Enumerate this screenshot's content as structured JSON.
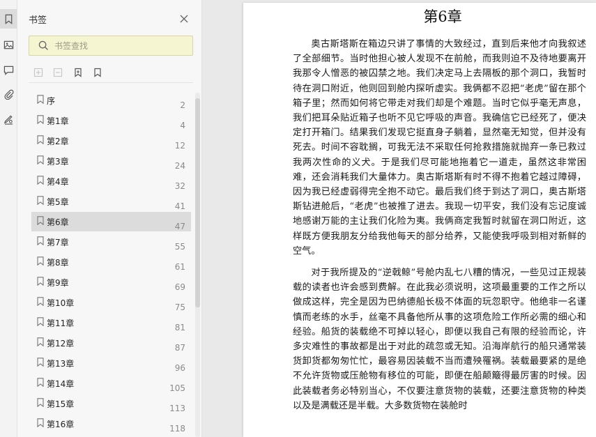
{
  "sidebar_panel": {
    "title": "书签",
    "search_placeholder": "书签查找",
    "bookmarks": [
      {
        "label": "序",
        "page": "2"
      },
      {
        "label": "第1章",
        "page": "4"
      },
      {
        "label": "第2章",
        "page": "12"
      },
      {
        "label": "第3章",
        "page": "24"
      },
      {
        "label": "第4章",
        "page": "32"
      },
      {
        "label": "第5章",
        "page": "41"
      },
      {
        "label": "第6章",
        "page": "47",
        "selected": true
      },
      {
        "label": "第7章",
        "page": "55"
      },
      {
        "label": "第8章",
        "page": "61"
      },
      {
        "label": "第9章",
        "page": "69"
      },
      {
        "label": "第10章",
        "page": "75"
      },
      {
        "label": "第11章",
        "page": "81"
      },
      {
        "label": "第12章",
        "page": "87"
      },
      {
        "label": "第13章",
        "page": "96"
      },
      {
        "label": "第14章",
        "page": "105"
      },
      {
        "label": "第15章",
        "page": "113"
      },
      {
        "label": "第16章",
        "page": "118"
      }
    ]
  },
  "icons": {
    "rail": [
      "bookmark-icon",
      "image-icon",
      "comment-icon",
      "attachment-icon",
      "signature-icon"
    ],
    "toolbar": [
      "expand-all-icon",
      "collapse-all-icon",
      "add-bookmark-icon",
      "bookmark-outline-icon"
    ]
  },
  "colors": {
    "search_bg": "#f5f5d1",
    "selected_bg": "#dcdcdc",
    "page_bg": "#ffffff"
  },
  "document": {
    "chapter_title": "第6章",
    "paragraphs": [
      "奥古斯塔斯在箱边只讲了事情的大致经过，直到后来他才向我叙述了全部细节。当时他担心被人发现不在前舱，而我则迫不及待地要离开我那令人憎恶的被囚禁之地。我们决定马上去隔板的那个洞口，我暂时待在洞口附近，他则回到舱内探听虚实。我俩都不忍把“老虎”留在那个箱子里；然而如何将它带走对我们却是个难题。当时它似乎毫无声息，我们把耳朵贴近箱子也听不见它呼吸的声音。我确信它已经死了，便决定打开箱门。结果我们发现它挺直身子躺着，显然毫无知觉，但并没有死去。时间不容耽搁，可我无法不采取任何抢救措施就抛弃一条已救过我两次性命的义犬。于是我们尽可能地拖着它一道走，虽然这非常困难，还会消耗我们大量体力。奥古斯塔斯有时不得不抱着它越过障碍，因为我已经虚弱得完全抱不动它。最后我们终于到达了洞口，奥古斯塔斯钻进舱后，“老虎”也被推了进去。我现一切平安，我们没有忘记度诚地感谢万能的主让我们化险为夷。我俩商定我暂时就留在洞口附近，这样既方便我朋友分给我他每天的部分给养，又能使我呼吸到相对新鲜的空气。",
      "对于我所提及的“逆戟鲸”号舱内乱七八糟的情况，一些见过正规装载的读者也许会感到费解。在此我必须说明，这项最重要的工作之所以做成这样，完全是因为巴纳德船长极不体面的玩忽职守。他绝非一名谨慎而老练的水手，丝毫不具备他所从事的这项危险工作所必需的细心和经验。船货的装载绝不可掉以轻心，即便以我自己有限的经验而论，许多灾难性的事故都是出于对此的疏忽或无知。沿海岸航行的船只通常装货卸货都匆匆忙忙，最容易因装载不当而遭殃罹祸。装载最要紧的是绝不允许货物或压舱物有移位的可能，即便在船颠簸得最厉害的时候。因此装载者务必特别当心，不仅要注意货物的装载，还要注意货物的种类以及是满载还是半载。大多数货物在装舱时"
    ]
  }
}
